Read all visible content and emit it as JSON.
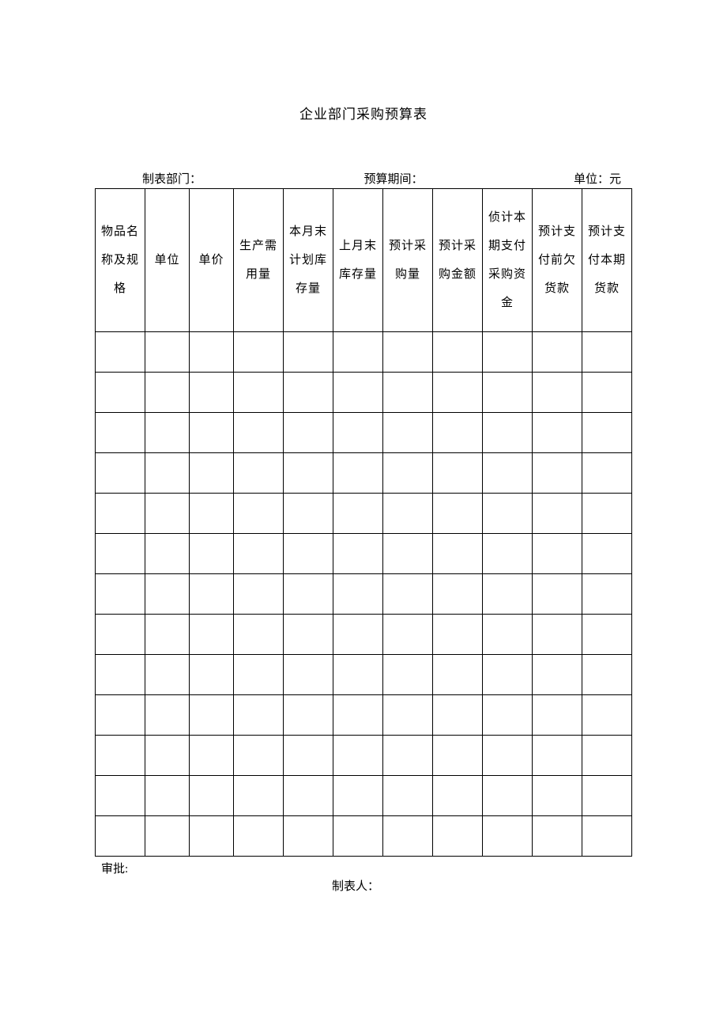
{
  "title": "企业部门采购预算表",
  "meta": {
    "dept_label": "制表部门：",
    "period_label": "预算期间：",
    "unit_label": "单位：元"
  },
  "headers": [
    "物品名称及规格",
    "单位",
    "单价",
    "生产需用量",
    "本月末计划库存量",
    "上月末库存量",
    "预计采购量",
    "预计采购金额",
    "侦计本期支付采购资金",
    "预计支付前欠货款",
    "预计支付本期货款"
  ],
  "rows": [
    [
      "",
      "",
      "",
      "",
      "",
      "",
      "",
      "",
      "",
      "",
      ""
    ],
    [
      "",
      "",
      "",
      "",
      "",
      "",
      "",
      "",
      "",
      "",
      ""
    ],
    [
      "",
      "",
      "",
      "",
      "",
      "",
      "",
      "",
      "",
      "",
      ""
    ],
    [
      "",
      "",
      "",
      "",
      "",
      "",
      "",
      "",
      "",
      "",
      ""
    ],
    [
      "",
      "",
      "",
      "",
      "",
      "",
      "",
      "",
      "",
      "",
      ""
    ],
    [
      "",
      "",
      "",
      "",
      "",
      "",
      "",
      "",
      "",
      "",
      ""
    ],
    [
      "",
      "",
      "",
      "",
      "",
      "",
      "",
      "",
      "",
      "",
      ""
    ],
    [
      "",
      "",
      "",
      "",
      "",
      "",
      "",
      "",
      "",
      "",
      ""
    ],
    [
      "",
      "",
      "",
      "",
      "",
      "",
      "",
      "",
      "",
      "",
      ""
    ],
    [
      "",
      "",
      "",
      "",
      "",
      "",
      "",
      "",
      "",
      "",
      ""
    ],
    [
      "",
      "",
      "",
      "",
      "",
      "",
      "",
      "",
      "",
      "",
      ""
    ],
    [
      "",
      "",
      "",
      "",
      "",
      "",
      "",
      "",
      "",
      "",
      ""
    ],
    [
      "",
      "",
      "",
      "",
      "",
      "",
      "",
      "",
      "",
      "",
      ""
    ]
  ],
  "footer": {
    "approve_label": "审批:",
    "preparer_label": "制表人："
  },
  "chart_data": {
    "type": "table",
    "title": "企业部门采购预算表",
    "columns": [
      "物品名称及规格",
      "单位",
      "单价",
      "生产需用量",
      "本月末计划库存量",
      "上月末库存量",
      "预计采购量",
      "预计采购金额",
      "侦计本期支付采购资金",
      "预计支付前欠货款",
      "预计支付本期货款"
    ],
    "rows": []
  }
}
